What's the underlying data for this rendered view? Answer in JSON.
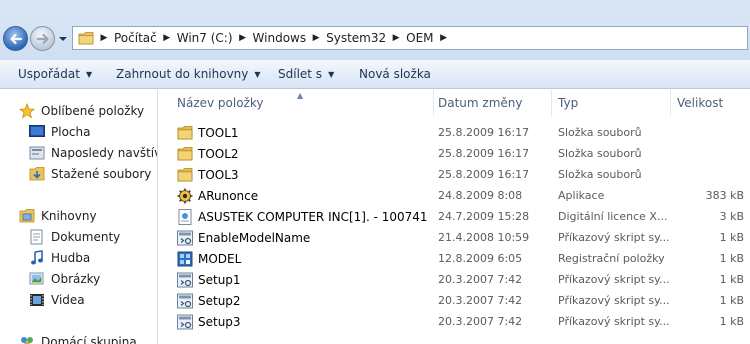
{
  "address": {
    "crumbs": [
      "Počítač",
      "Win7 (C:)",
      "Windows",
      "System32",
      "OEM"
    ]
  },
  "commands": {
    "organize": "Uspořádat",
    "include": "Zahrnout do knihovny",
    "share": "Sdílet s",
    "new_folder": "Nová složka"
  },
  "nav": {
    "favorites": "Oblíbené položky",
    "desktop": "Plocha",
    "recent": "Naposledy navštíver",
    "downloads": "Stažené soubory",
    "libraries": "Knihovny",
    "documents": "Dokumenty",
    "music": "Hudba",
    "pictures": "Obrázky",
    "videos": "Videa",
    "homegroup": "Domácí skupina"
  },
  "columns": {
    "name": "Název položky",
    "date": "Datum změny",
    "type": "Typ",
    "size": "Velikost"
  },
  "files": [
    {
      "name": "TOOL1",
      "date": "25.8.2009 16:17",
      "type": "Složka souborů",
      "size": "",
      "icon": "folder-icon"
    },
    {
      "name": "TOOL2",
      "date": "25.8.2009 16:17",
      "type": "Složka souborů",
      "size": "",
      "icon": "folder-icon"
    },
    {
      "name": "TOOL3",
      "date": "25.8.2009 16:17",
      "type": "Složka souborů",
      "size": "",
      "icon": "folder-icon"
    },
    {
      "name": "ARunonce",
      "date": "24.8.2009 8:08",
      "type": "Aplikace",
      "size": "383 kB",
      "icon": "application-icon"
    },
    {
      "name": "ASUSTEK COMPUTER INC[1]. - 100741",
      "date": "24.7.2009 15:28",
      "type": "Digitální licence X...",
      "size": "3 kB",
      "icon": "license-icon"
    },
    {
      "name": "EnableModelName",
      "date": "21.4.2008 10:59",
      "type": "Příkazový skript sy...",
      "size": "1 kB",
      "icon": "script-icon"
    },
    {
      "name": "MODEL",
      "date": "12.8.2009 6:05",
      "type": "Registrační položky",
      "size": "1 kB",
      "icon": "registry-icon"
    },
    {
      "name": "Setup1",
      "date": "20.3.2007 7:42",
      "type": "Příkazový skript sy...",
      "size": "1 kB",
      "icon": "script-icon"
    },
    {
      "name": "Setup2",
      "date": "20.3.2007 7:42",
      "type": "Příkazový skript sy...",
      "size": "1 kB",
      "icon": "script-icon"
    },
    {
      "name": "Setup3",
      "date": "20.3.2007 7:42",
      "type": "Příkazový skript sy...",
      "size": "1 kB",
      "icon": "script-icon"
    }
  ]
}
